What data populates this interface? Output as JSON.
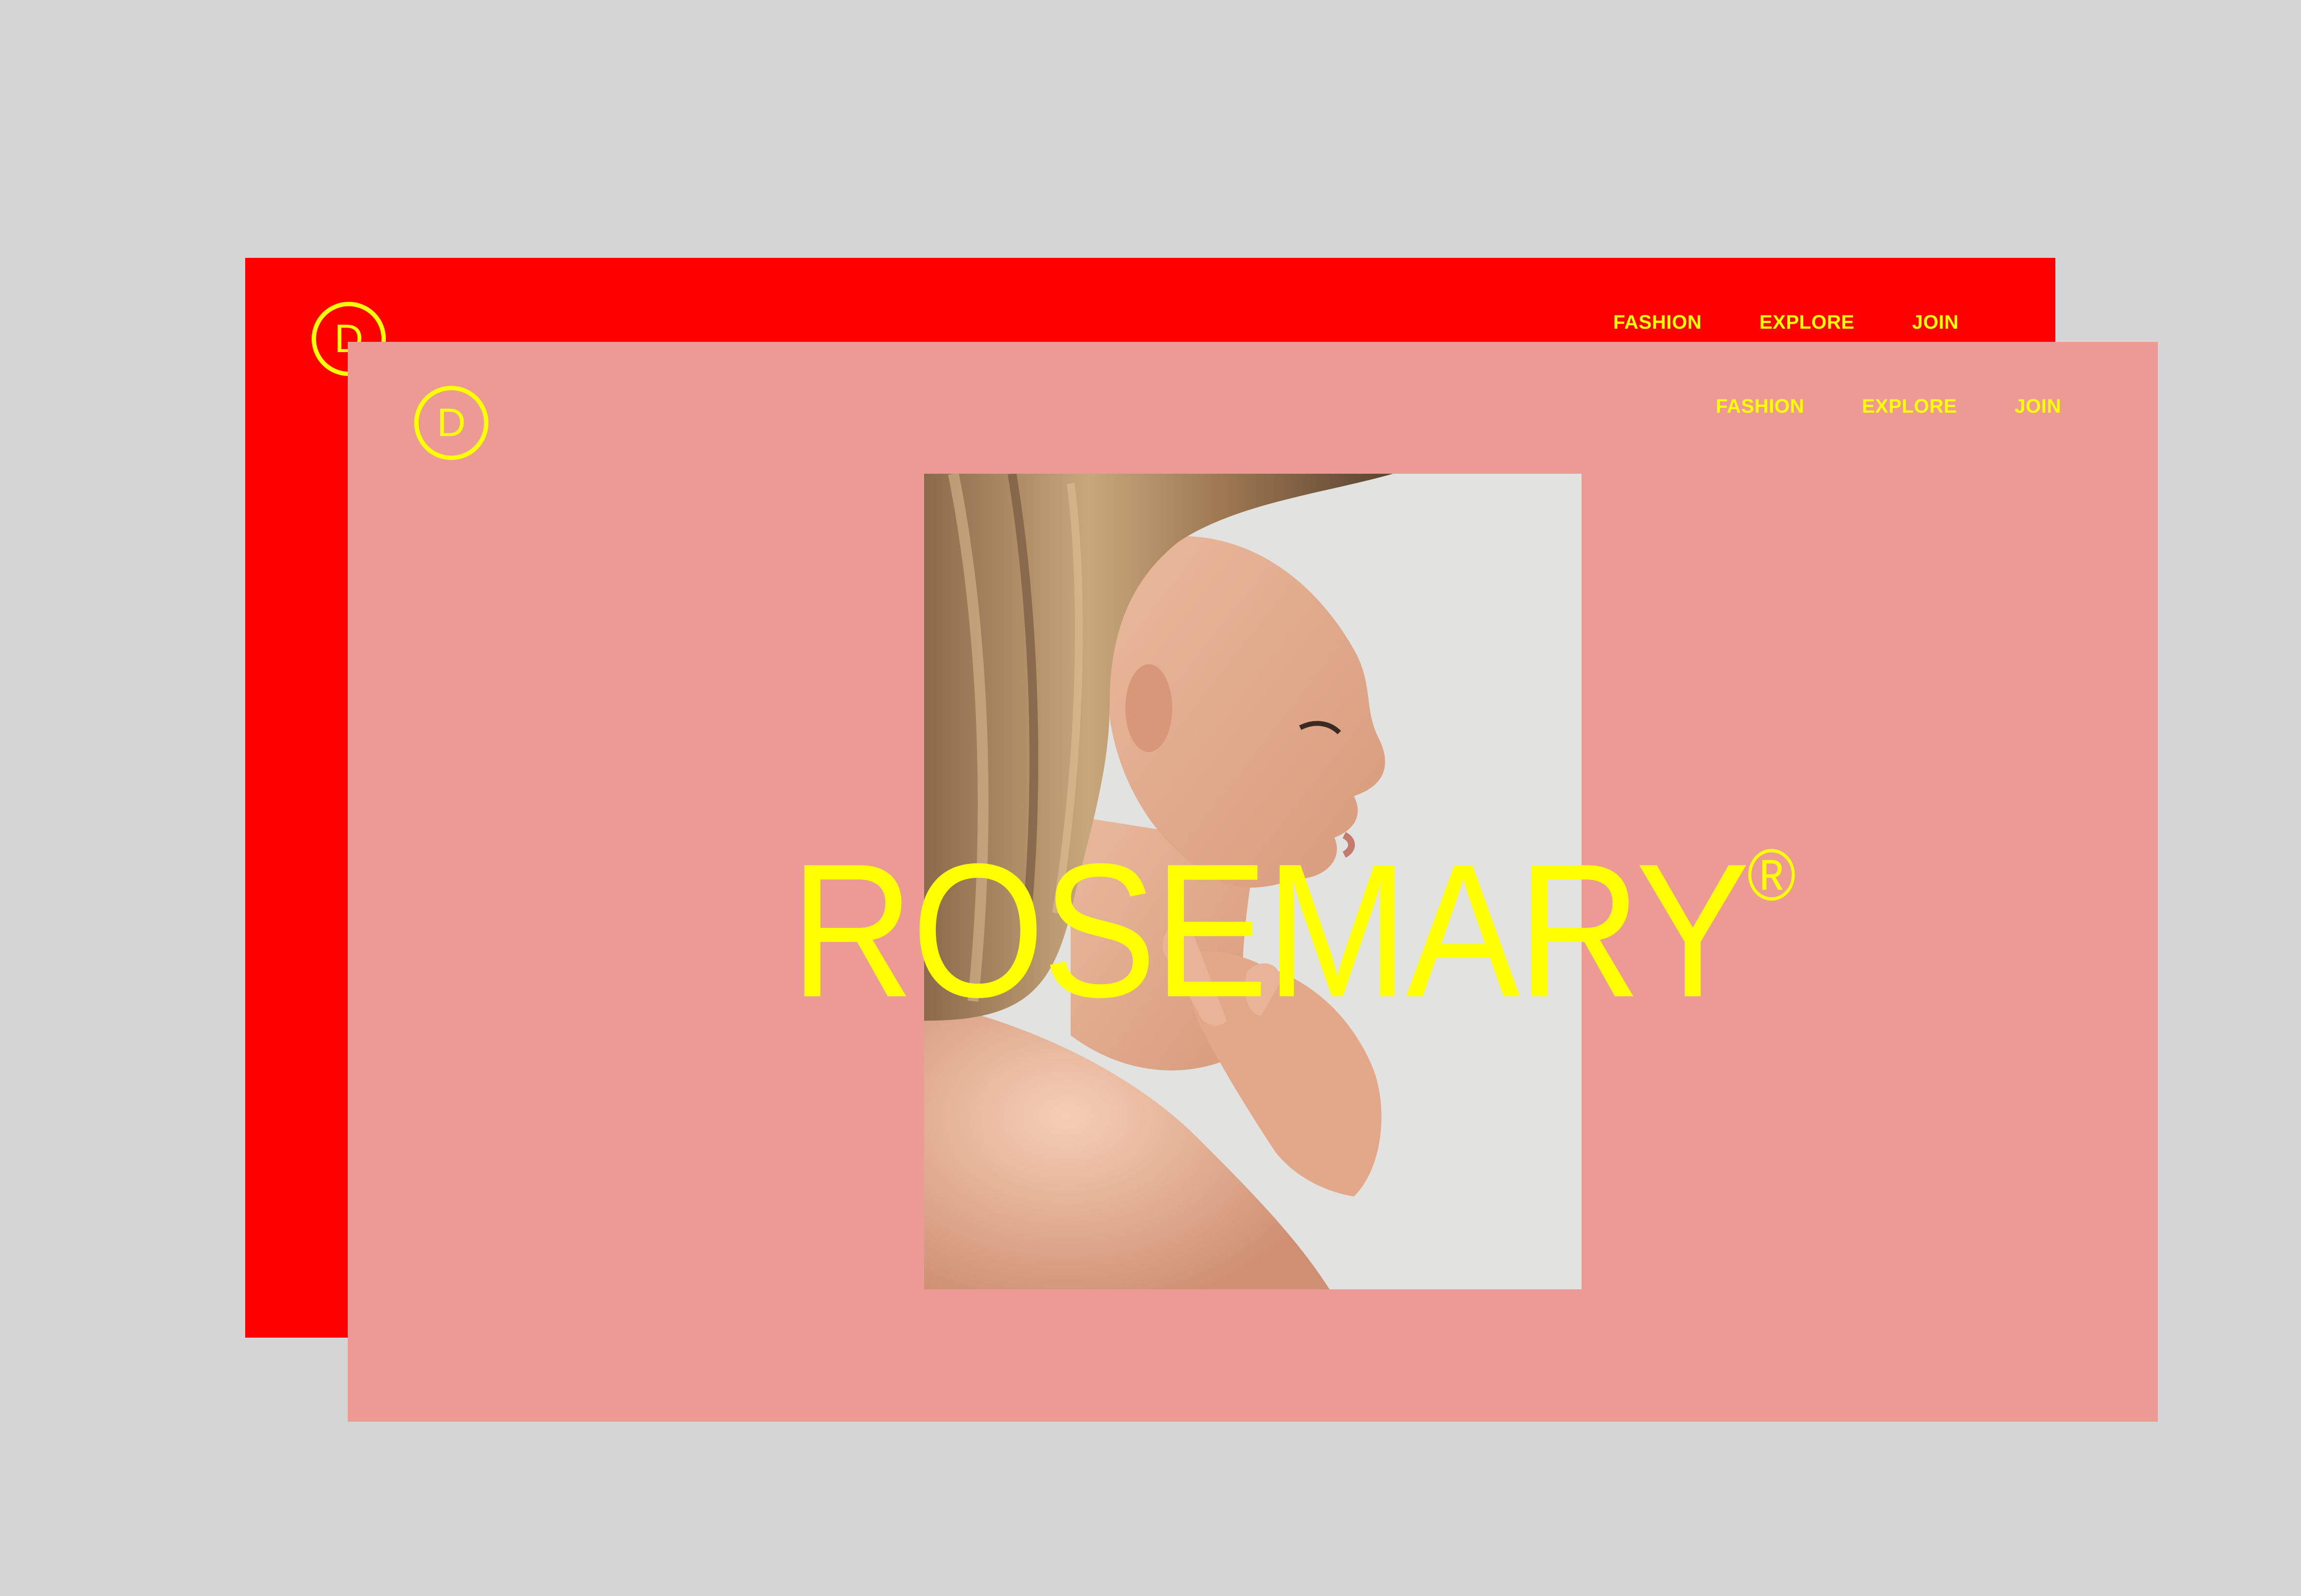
{
  "colors": {
    "background": "#d6d6d6",
    "back_card": "#ff0000",
    "front_card": "#ec9a93",
    "accent_text": "#ffff00"
  },
  "back_card": {
    "logo_letter": "D",
    "nav": [
      "FASHION",
      "EXPLORE",
      "JOIN"
    ]
  },
  "front_card": {
    "logo_letter": "D",
    "nav": [
      "FASHION",
      "EXPLORE",
      "JOIN"
    ],
    "headline": "ROSEMARY",
    "headline_mark": "®",
    "hero_image_icon": "woman-profile-photo"
  }
}
